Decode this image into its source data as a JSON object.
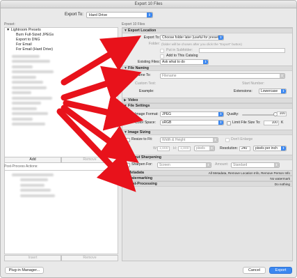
{
  "window": {
    "title": "Export 10 Files"
  },
  "export_to": {
    "label": "Export To:",
    "value": "Hard Drive"
  },
  "left": {
    "preset_header": "Preset:",
    "folder": "Lightroom Presets",
    "presets": [
      "Burn Full-Sized JPEGs",
      "Export to DNG",
      "For Email",
      "For Email (Hard Drive)"
    ],
    "add_label": "Add",
    "remove_label": "Remove",
    "post_header": "Post-Process Actions:",
    "insert_label": "Insert",
    "remove2_label": "Remove"
  },
  "right": {
    "header": "Export 10 Files",
    "export_location": {
      "title": "Export Location",
      "export_to_label": "Export To:",
      "export_to_value": "Choose folder later (useful for presets)",
      "folder_label": "Folder:",
      "folder_value": "(folder will be chosen after you click the \"Export\" button)",
      "subfolder_label": "Put in Subfolder:",
      "add_catalog_label": "Add to This Catalog",
      "existing_label": "Existing Files:",
      "existing_value": "Ask what to do"
    },
    "file_naming": {
      "title": "File Naming",
      "rename_label": "Rename To:",
      "rename_value": "Filename",
      "custom_label": "Custom Text:",
      "start_label": "Start Number:",
      "example_label": "Example:",
      "extensions_label": "Extensions:",
      "extensions_value": "Lowercase"
    },
    "video": {
      "title": "Video"
    },
    "file_settings": {
      "title": "File Settings",
      "format_label": "Image Format:",
      "format_value": "JPEG",
      "quality_label": "Quality:",
      "quality_value": "100",
      "quality_level": 1.0,
      "colorspace_label": "Color Space:",
      "colorspace_value": "sRGB",
      "limit_label": "Limit File Size To:",
      "limit_value": "100",
      "limit_unit": "K"
    },
    "image_sizing": {
      "title": "Image Sizing",
      "resize_label": "Resize to Fit:",
      "resize_value": "Width & Height",
      "dont_enlarge": "Don't Enlarge",
      "w_label": "W:",
      "w_value": "1,000",
      "h_label": "H:",
      "h_value": "1,000",
      "units": "pixels",
      "resolution_label": "Resolution:",
      "resolution_value": "240",
      "resolution_units": "pixels per inch"
    },
    "output_sharpening": {
      "title": "Output Sharpening",
      "sharpen_label": "Sharpen For:",
      "sharpen_value": "Screen",
      "amount_label": "Amount:",
      "amount_value": "Standard"
    },
    "metadata": {
      "title": "Metadata",
      "summary": "All Metadata, Remove Location Info, Remove Person Info"
    },
    "watermarking": {
      "title": "Watermarking",
      "summary": "No watermark"
    },
    "post_processing": {
      "title": "Post-Processing",
      "summary": "Do nothing"
    }
  },
  "buttons": {
    "plugin_manager": "Plug-in Manager...",
    "cancel": "Cancel",
    "export": "Export"
  },
  "colors": {
    "accent": "#3b87f0",
    "arrow": "#e8121b"
  },
  "icons": {
    "disclosure_open": "▼",
    "disclosure_closed": "▶",
    "caret": "⌃⌄"
  }
}
